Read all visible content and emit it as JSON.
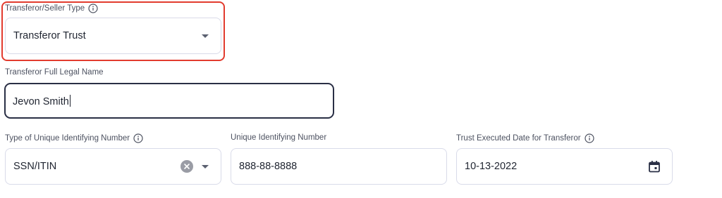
{
  "seller_type": {
    "label": "Transferor/Seller Type",
    "value": "Transferor Trust",
    "info_icon": "info-icon"
  },
  "full_name": {
    "label": "Transferor Full Legal Name",
    "value": "Jevon Smith"
  },
  "id_type": {
    "label": "Type of Unique Identifying Number",
    "value": "SSN/ITIN",
    "info_icon": "info-icon",
    "clear_icon": "clear-icon"
  },
  "id_number": {
    "label": "Unique Identifying Number",
    "value": "888-88-8888"
  },
  "trust_date": {
    "label": "Trust Executed Date for Transferor",
    "value": "10-13-2022",
    "info_icon": "info-icon",
    "calendar_icon": "calendar-icon"
  },
  "colors": {
    "highlight": "#e23b2e",
    "focused_border": "#2a2f45",
    "field_border": "#d9dbe9",
    "text": "#1f2430"
  }
}
